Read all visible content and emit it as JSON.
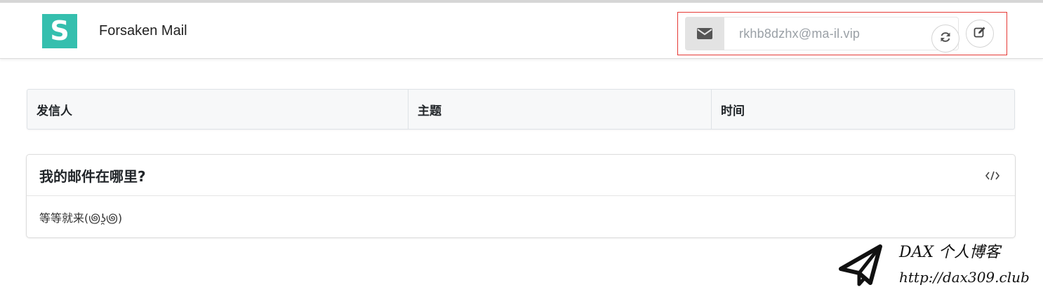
{
  "header": {
    "logo_letter": "S",
    "brand": "Forsaken Mail",
    "mail_address": "rkhb8dzhx@ma-il.vip",
    "icons": {
      "mail": "envelope-icon",
      "refresh": "refresh-icon",
      "edit": "edit-icon"
    }
  },
  "table": {
    "columns": [
      "发信人",
      "主题",
      "时间"
    ]
  },
  "card": {
    "title": "我的邮件在哪里?",
    "body": "等等就来(಄ʖ̯಄)",
    "icon": "code-icon"
  },
  "watermark": {
    "title": "DAX 个人博客",
    "url": "http://dax309.club",
    "icon": "paper-plane-icon"
  },
  "colors": {
    "brand_teal": "#35bfae",
    "highlight_border": "#e53935"
  }
}
